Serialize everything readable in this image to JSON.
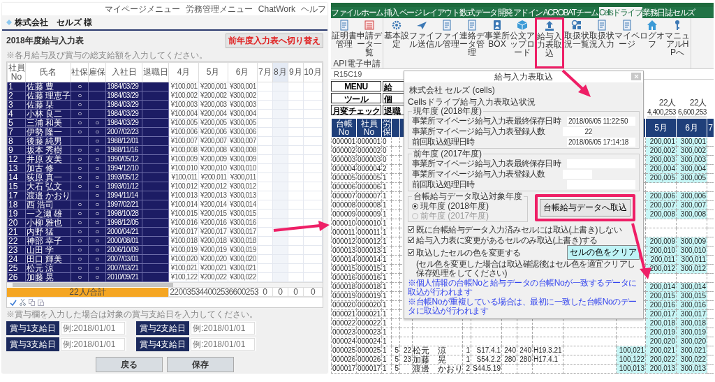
{
  "left_page": {
    "nav": [
      "マイページメニュー",
      "労務管理メニュー",
      "ChatWork",
      "ヘルフ"
    ],
    "company": "株式会社　セルズ 様",
    "title": "2018年度給与入力表",
    "switch_button": "前年度入力表へ切り替え",
    "note": "※各月給与及び賞与の総支給額を入力してください。",
    "table": {
      "columns": [
        {
          "label": "社員No",
          "selected": false
        },
        {
          "label": "氏名",
          "selected": false
        },
        {
          "label": "社保",
          "selected": false
        },
        {
          "label": "雇保",
          "selected": false
        },
        {
          "label": "入社日",
          "selected": false
        },
        {
          "label": "退職日",
          "selected": false
        },
        {
          "label": "4月",
          "selected": false
        },
        {
          "label": "5月",
          "selected": false
        },
        {
          "label": "6月",
          "selected": false
        },
        {
          "label": "7月",
          "selected": false
        },
        {
          "label": "8月",
          "selected": true
        },
        {
          "label": "9月",
          "selected": false
        },
        {
          "label": "10月",
          "selected": false
        }
      ],
      "rows": [
        {
          "no": "1",
          "name": "佐藤 豊",
          "shaho": "○",
          "joined": "1984/03/29",
          "amounts": [
            "¥100,001",
            "¥200,001",
            "¥300,001"
          ]
        },
        {
          "no": "2",
          "name": "佐藤 理恵子",
          "shaho": "○",
          "joined": "1984/03/29",
          "amounts": [
            "¥100,002",
            "¥200,002",
            "¥300,002"
          ]
        },
        {
          "no": "3",
          "name": "佐藤 栞",
          "shaho": "○",
          "joined": "1984/03/29",
          "amounts": [
            "¥100,003",
            "¥200,003",
            "¥300,003"
          ]
        },
        {
          "no": "4",
          "name": "小林 良二",
          "shaho": "○",
          "joined": "1984/03/29",
          "amounts": [
            "¥100,004",
            "¥200,004",
            "¥300,004"
          ]
        },
        {
          "no": "5",
          "name": "三浦 和美",
          "shaho": "○",
          "koho": "○",
          "joined": "1984/03/29",
          "amounts": [
            "¥100,005",
            "¥200,005",
            "¥300,005"
          ]
        },
        {
          "no": "7",
          "name": "伊勢 隆一",
          "shaho": "○",
          "koho": "○",
          "joined": "2007/02/23",
          "amounts": [
            "¥100,006",
            "¥200,006",
            "¥300,006"
          ]
        },
        {
          "no": "8",
          "name": "後藤 純男",
          "koho": "○",
          "joined": "1988/12/01",
          "amounts": [
            "¥100,007",
            "¥200,007",
            "¥300,007"
          ]
        },
        {
          "no": "9",
          "name": "坂本 秀樹",
          "shaho": "○",
          "koho": "○",
          "joined": "1988/11/16",
          "amounts": [
            "¥100,008",
            "¥200,008",
            "¥300,008"
          ]
        },
        {
          "no": "12",
          "name": "井原 友美",
          "shaho": "○",
          "koho": "○",
          "joined": "1990/05/12",
          "amounts": [
            "¥100,009",
            "¥200,009",
            "¥300,009"
          ]
        },
        {
          "no": "13",
          "name": "加古 修",
          "shaho": "○",
          "koho": "○",
          "joined": "1994/12/10",
          "amounts": [
            "¥100,010",
            "¥200,010",
            "¥300,010"
          ]
        },
        {
          "no": "14",
          "name": "荻原 真一",
          "shaho": "○",
          "koho": "○",
          "joined": "1993/05/12",
          "amounts": [
            "¥100,011",
            "¥200,011",
            "¥300,011"
          ]
        },
        {
          "no": "15",
          "name": "大石 弘文",
          "shaho": "○",
          "koho": "○",
          "joined": "1993/01/12",
          "amounts": [
            "¥100,012",
            "¥200,012",
            "¥300,012"
          ]
        },
        {
          "no": "17",
          "name": "渡邉 かおり",
          "koho": "○",
          "joined": "1994/11/14",
          "amounts": [
            "¥100,013",
            "¥200,013",
            "¥300,013"
          ]
        },
        {
          "no": "18",
          "name": "西 浩司",
          "shaho": "○",
          "koho": "○",
          "joined": "1997/02/21",
          "amounts": [
            "¥100,014",
            "¥200,014",
            "¥300,014"
          ]
        },
        {
          "no": "19",
          "name": "一之瀬 雄",
          "shaho": "○",
          "koho": "○",
          "joined": "1998/10/28",
          "amounts": [
            "¥100,015",
            "¥200,015",
            "¥300,015"
          ]
        },
        {
          "no": "20",
          "name": "小柳 雅也",
          "shaho": "○",
          "koho": "○",
          "joined": "1998/12/05",
          "amounts": [
            "¥100,016",
            "¥200,016",
            "¥300,016"
          ]
        },
        {
          "no": "21",
          "name": "内野 猛",
          "shaho": "○",
          "koho": "○",
          "joined": "2000/04/21",
          "amounts": [
            "¥100,017",
            "¥200,017",
            "¥300,017"
          ]
        },
        {
          "no": "22",
          "name": "神部 幸子",
          "shaho": "○",
          "koho": "○",
          "joined": "2000/08/01",
          "amounts": [
            "¥100,018",
            "¥200,018",
            "¥300,018"
          ]
        },
        {
          "no": "23",
          "name": "山田 学",
          "shaho": "○",
          "koho": "○",
          "joined": "2006/10/09",
          "amounts": [
            "¥100,019",
            "¥200,019",
            "¥300,019"
          ]
        },
        {
          "no": "24",
          "name": "田口 輝美",
          "shaho": "○",
          "koho": "○",
          "joined": "2007/03/01",
          "amounts": [
            "¥100,020",
            "¥200,020",
            "¥300,020"
          ]
        },
        {
          "no": "25",
          "name": "松元 涼",
          "shaho": "○",
          "koho": "○",
          "joined": "2007/03/21",
          "amounts": [
            "¥100,021",
            "¥200,021",
            "¥300,021"
          ]
        },
        {
          "no": "26",
          "name": "加藤 晃",
          "shaho": "○",
          "koho": "○",
          "joined": "2010/09/21",
          "amounts": [
            "¥100,122",
            "¥200,022",
            "¥300,022"
          ]
        }
      ],
      "total_label": "22人/合計",
      "totals": [
        "2200353",
        "4400253",
        "6600253",
        "0",
        "0",
        "0",
        "0"
      ]
    },
    "note2": "※賞与欄を入力した場合は対象の賞与支給日を入力してください。",
    "bonus_dates": [
      {
        "label": "賞与1支給日",
        "placeholder": "例:2018/01/01"
      },
      {
        "label": "賞与2支給日",
        "placeholder": "例:2018/01/01"
      },
      {
        "label": "賞与3支給日",
        "placeholder": "例:2018/01/01"
      },
      {
        "label": "賞与4支給日",
        "placeholder": "例:2018/01/01"
      }
    ],
    "buttons": [
      "戻る",
      "保存"
    ]
  },
  "excel": {
    "tabs": [
      {
        "label": "ファイル",
        "selected": false
      },
      {
        "label": "ホーム",
        "selected": false
      },
      {
        "label": "挿入",
        "selected": false
      },
      {
        "label": "ページ レイアウト",
        "selected": false
      },
      {
        "label": "数式",
        "selected": false
      },
      {
        "label": "データ",
        "selected": false
      },
      {
        "label": "開発",
        "selected": false
      },
      {
        "label": "アドイン",
        "selected": false
      },
      {
        "label": "ACROBAT",
        "selected": false
      },
      {
        "label": "チーム",
        "selected": false
      },
      {
        "label": "Cellsドライブ",
        "selected": true
      },
      {
        "label": "業務日誌",
        "selected": false
      },
      {
        "label": "セルズ",
        "selected": false
      }
    ],
    "ribbon_groups": [
      {
        "label": "API電子申請",
        "buttons": [
          {
            "label": "証明書管理",
            "highlighted": false
          },
          {
            "label": "申請データ一覧",
            "highlighted": false
          }
        ]
      },
      {
        "buttons": [
          {
            "label": "基本設定",
            "highlighted": false
          },
          {
            "label": "ファイル送信",
            "highlighted": false
          },
          {
            "label": "ファイル管理",
            "highlighted": false
          },
          {
            "label": "連絡データ管理",
            "highlighted": false
          },
          {
            "label": "事業所BOX",
            "highlighted": false
          },
          {
            "label": "公文アップロード",
            "highlighted": false
          },
          {
            "label": "給与入力表取込",
            "highlighted": true
          },
          {
            "label": "取扱状況一覧",
            "highlighted": false
          },
          {
            "label": "取扱状況入力",
            "highlighted": false
          },
          {
            "label": "マイページ",
            "highlighted": false
          },
          {
            "label": "ログオフ",
            "highlighted": false
          },
          {
            "label": "マニュアルHPへ",
            "highlighted": false
          }
        ]
      }
    ],
    "name_box": "R15C19",
    "sheet_buttons": [
      "MENU",
      "給",
      "ツール",
      "個",
      "月変チェック",
      "退職"
    ],
    "summary": [
      {
        "count": "22人",
        "total": "4,400,253"
      },
      {
        "count": "22人",
        "total": "6,600,253"
      }
    ],
    "headers": {
      "ledger": "台帳No",
      "emp": "社員No",
      "c3": "労保",
      "may": "5月",
      "jun": "6月",
      "jul": "7"
    },
    "rows": [
      {
        "ledger": "000001",
        "emp": "000001",
        "c3": "0",
        "may": "200,001",
        "jun": "300,001"
      },
      {
        "ledger": "000002",
        "emp": "000002",
        "c3": "0",
        "may": "200,002",
        "jun": "300,002"
      },
      {
        "ledger": "000003",
        "emp": "000003",
        "c3": "0",
        "may": "200,003",
        "jun": "300,003"
      },
      {
        "ledger": "000004",
        "emp": "000004",
        "c3": "2",
        "may": "200,004",
        "jun": "300,004"
      },
      {
        "ledger": "000005",
        "emp": "000005",
        "c3": "1",
        "may": "200,005",
        "jun": "300,005"
      },
      {
        "ledger": "000006",
        "emp": "000006",
        "c3": "1"
      },
      {
        "ledger": "000007",
        "emp": "000007",
        "c3": "1",
        "may": "200,006",
        "jun": "300,006"
      },
      {
        "ledger": "000008",
        "emp": "000008",
        "c3": "1",
        "may": "200,007",
        "jun": "300,007"
      },
      {
        "ledger": "000009",
        "emp": "000009",
        "c3": "1",
        "may": "200,008",
        "jun": "300,008"
      },
      {
        "ledger": "000010",
        "emp": "000010",
        "c3": "1"
      },
      {
        "ledger": "000011",
        "emp": "000011",
        "c3": "1"
      },
      {
        "ledger": "000012",
        "emp": "000012",
        "c3": "1",
        "may": "200,009",
        "jun": "300,009"
      },
      {
        "ledger": "000013",
        "emp": "000013",
        "c3": "1",
        "may": "200,010",
        "jun": "300,010"
      },
      {
        "ledger": "000014",
        "emp": "000014",
        "c3": "1",
        "may": "200,011",
        "jun": "300,011"
      },
      {
        "ledger": "000015",
        "emp": "000015",
        "c3": "1",
        "may": "200,012",
        "jun": "300,012"
      },
      {
        "ledger": "000016",
        "emp": "000016",
        "c3": "1"
      },
      {
        "ledger": "000018",
        "emp": "000018",
        "c3": "1",
        "may": "200,014",
        "jun": "300,014"
      },
      {
        "ledger": "000019",
        "emp": "000019",
        "c3": "1",
        "may": "200,015",
        "jun": "300,015"
      },
      {
        "ledger": "000020",
        "emp": "000020",
        "c3": "1",
        "may": "200,016",
        "jun": "300,016"
      },
      {
        "ledger": "000021",
        "emp": "000021",
        "c3": "1",
        "may": "200,017",
        "jun": "300,017"
      },
      {
        "ledger": "000022",
        "emp": "000022",
        "c3": "1",
        "may": "200,018",
        "jun": "300,018"
      },
      {
        "ledger": "000023",
        "emp": "000023",
        "c3": "1",
        "may": "200,019",
        "jun": "300,019"
      },
      {
        "ledger": "000024",
        "emp": "000024",
        "c3": "1",
        "may": "200,020",
        "jun": "300,020"
      },
      {
        "ledger": "000025",
        "emp": "000025",
        "c3": "1",
        "c4": "5",
        "c5": "22",
        "name": "松元　涼",
        "c7": "1",
        "birth": "S17.4.1",
        "c9": "240",
        "c10": "240",
        "date": "H19.3.21",
        "apr": "100,021",
        "may": "200,021",
        "jun": "300,021"
      },
      {
        "ledger": "000026",
        "emp": "000026",
        "c3": "1",
        "c4": "5",
        "c5": "23",
        "name": "加藤　晃",
        "c7": "1",
        "birth": "S54.2.2",
        "c9": "280",
        "c10": "280",
        "date": "H17.4.1",
        "apr": "100,122",
        "may": "200,022",
        "jun": "300,022"
      },
      {
        "ledger": "000017",
        "emp": "000017",
        "c3": "1",
        "c4": "5",
        "name": "渡邊　かおり",
        "c7": "2",
        "birth": "S44.5.19",
        "apr": "100,013",
        "may": "200,013",
        "jun": "300,013"
      }
    ],
    "dialog": {
      "title": "給与入力表取込",
      "company": "株式会社  セルズ (cells)",
      "status_heading": "Cellsドライブ給与入力表取込状況",
      "groups": [
        {
          "label": "現年度 (2018年度)",
          "fields": [
            {
              "label": "事業所マイページ給与入力表最終保存日時",
              "value": "2018/06/05 11:22:50"
            },
            {
              "label": "事業所マイページ給与入力表登録人数",
              "value": "22"
            },
            {
              "label": "前回取込処理日時",
              "value": "2018/06/05 17:14:18"
            }
          ]
        },
        {
          "label": "前年度 (2017年度)",
          "fields": [
            {
              "label": "事業所マイページ給与入力表最終保存日時"
            },
            {
              "label": "事業所マイページ給与入力表登録人数"
            },
            {
              "label": "前回取込処理日時"
            }
          ]
        }
      ],
      "year_group": {
        "label": "台帳給与データ取込対象年度",
        "options": [
          {
            "label": "現年度 (2018年度)",
            "selected": true,
            "disabled": false
          },
          {
            "label": "前年度 (2017年度)",
            "selected": false,
            "disabled": true
          }
        ]
      },
      "import_button": "台帳給与データへ取込",
      "checks": [
        {
          "label": "既に台帳給与データ入力済みセルには取込(上書き)しない",
          "checked": true
        },
        {
          "label": "給与入力表に変更があるセルのみ取込(上書き)する",
          "checked": true
        },
        {
          "label": "取込したセルの色を変更する",
          "checked": true
        }
      ],
      "check_note": "(セル色を変更した場合は取込確認後はセル色を適宜クリアし保存処理をしてください)",
      "clear_button": "セルの色をクリア",
      "notes": [
        "※個人情報の台帳Noと給与データの台帳Noが一致するデータに取込が行われます",
        "※台帳Noが重複している場合は、最初に一致した台帳Noのデータに取込が行われます"
      ]
    }
  }
}
